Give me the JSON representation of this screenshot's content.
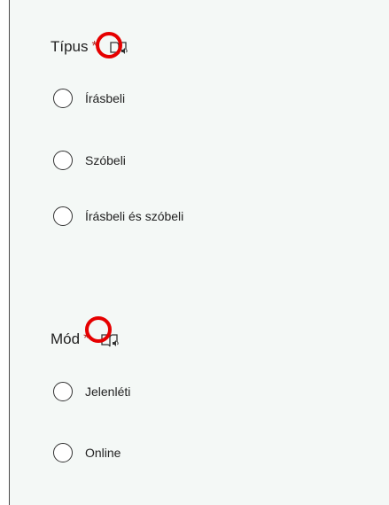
{
  "questions": [
    {
      "title": "Típus",
      "required_mark": "*",
      "icon": "immersive-reader-icon",
      "options": [
        "Írásbeli",
        "Szóbeli",
        "Írásbeli és szóbeli"
      ]
    },
    {
      "title": "Mód",
      "required_mark": "*",
      "icon": "immersive-reader-icon",
      "options": [
        "Jelenléti",
        "Online"
      ]
    }
  ],
  "colors": {
    "background": "#f4f8f6",
    "required": "#b3261e",
    "highlight_circle": "#e60000"
  }
}
